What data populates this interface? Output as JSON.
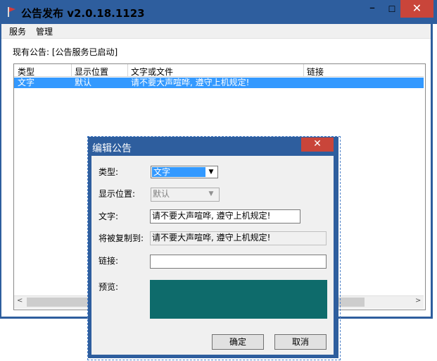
{
  "window": {
    "title": "公告发布 v2.0.18.1123",
    "minimize_glyph": "–",
    "maximize_glyph": "☐",
    "close_glyph": "✕"
  },
  "menu": {
    "items": [
      {
        "label": "服务"
      },
      {
        "label": "管理"
      }
    ]
  },
  "status": {
    "text": "现有公告: [公告服务已启动]"
  },
  "list": {
    "columns": [
      "类型",
      "显示位置",
      "文字或文件",
      "链接"
    ],
    "rows": [
      {
        "type": "文字",
        "position": "默认",
        "content": "请不要大声喧哗, 遵守上机规定!",
        "link": "",
        "selected": true
      }
    ]
  },
  "scrollbar": {
    "left_glyph": "<",
    "right_glyph": ">"
  },
  "dialog": {
    "title": "编辑公告",
    "close_glyph": "✕",
    "type_label": "类型:",
    "type_value": "文字",
    "position_label": "显示位置:",
    "position_value": "默认",
    "text_label": "文字:",
    "text_value": "请不要大声喧哗, 遵守上机规定!",
    "copy_label": "将被复制到:",
    "copy_value": "请不要大声喧哗, 遵守上机规定!",
    "link_label": "链接:",
    "link_value": "",
    "preview_label": "预览:",
    "preview_color": "#0e6b6b",
    "ok_label": "确定",
    "cancel_label": "取消",
    "dropdown_glyph": "▼"
  },
  "colors": {
    "titlebar": "#2e5e9e",
    "close_button": "#c9453a",
    "selection": "#3399ff"
  }
}
